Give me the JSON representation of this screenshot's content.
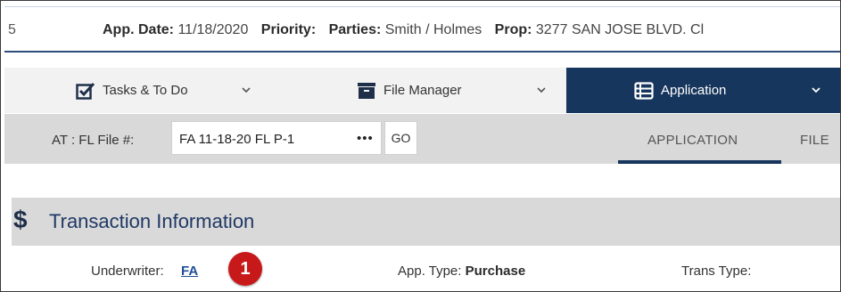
{
  "header": {
    "number": "5",
    "fields": [
      {
        "label": "App. Date:",
        "value": "11/18/2020"
      },
      {
        "label": "Priority:",
        "value": ""
      },
      {
        "label": "Parties:",
        "value": "Smith / Holmes"
      },
      {
        "label": "Prop:",
        "value": "3277 SAN JOSE BLVD. Cl"
      }
    ]
  },
  "nav": {
    "tasks": {
      "label": "Tasks & To Do",
      "icon": "checkbox-edit-icon"
    },
    "files": {
      "label": "File Manager",
      "icon": "folder-box-icon"
    },
    "application": {
      "label": "Application",
      "icon": "list-icon"
    }
  },
  "filebar": {
    "label": "AT : FL File #:",
    "file_value": "FA 11-18-20 FL P-1",
    "dots": "•••",
    "go_label": "GO",
    "tabs": [
      "APPLICATION",
      "FILE"
    ]
  },
  "section": {
    "icon": "$",
    "title": "Transaction Information"
  },
  "transaction": {
    "underwriter_label": "Underwriter:",
    "underwriter_value": "FA",
    "badge": "1",
    "app_type_label": "App. Type:",
    "app_type_value": "Purchase",
    "trans_type_label": "Trans Type:"
  },
  "colors": {
    "nav_active": "#17365d",
    "badge": "#c8191a",
    "link": "#1f4e96"
  }
}
